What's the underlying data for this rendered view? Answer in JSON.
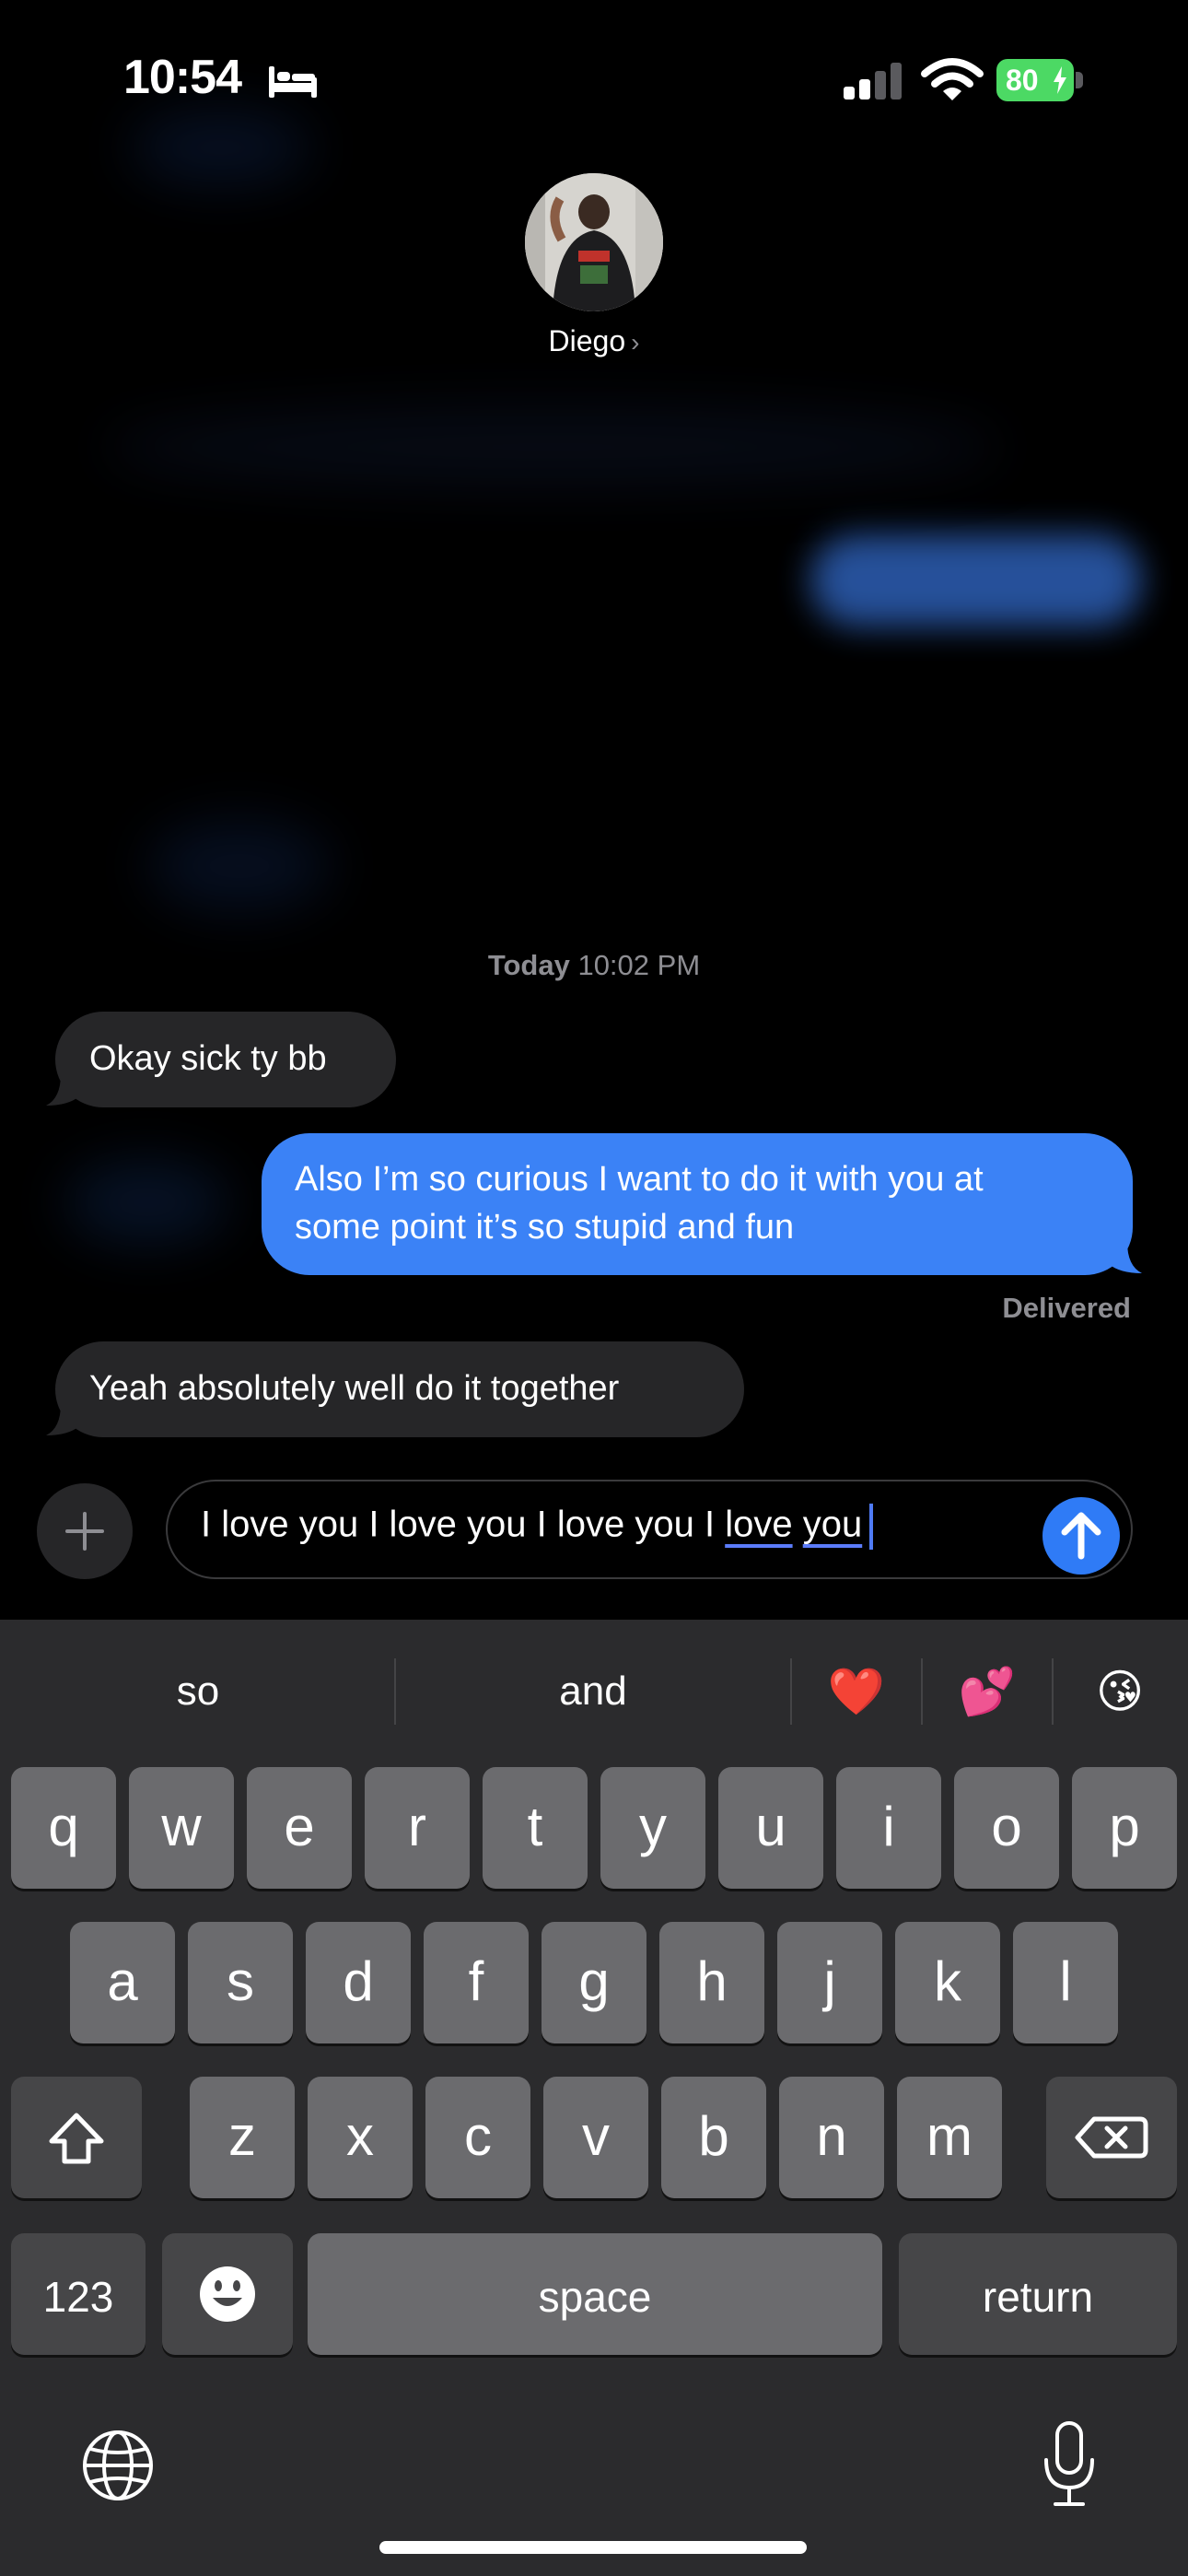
{
  "status_bar": {
    "time": "10:54",
    "battery": "80"
  },
  "contact": {
    "name": "Diego",
    "chevron": "›"
  },
  "conversation": {
    "timestamp_day": "Today",
    "timestamp_time": "10:02 PM",
    "messages": [
      {
        "direction": "incoming",
        "text": "Okay sick ty bb"
      },
      {
        "direction": "outgoing",
        "line1": "Also I’m so curious I want to do it with you at",
        "line2": "some point it’s so stupid and fun"
      },
      {
        "direction": "incoming",
        "text": "Yeah absolutely well do it together"
      }
    ],
    "delivered_label": "Delivered"
  },
  "composer": {
    "text_plain": "I love you I love you I love you I ",
    "text_underlined_1": "love",
    "text_underlined_2": "you"
  },
  "keyboard": {
    "predictions": [
      "so",
      "and"
    ],
    "emoji_predictions": [
      "❤️",
      "💕",
      "😘"
    ],
    "row1": [
      "q",
      "w",
      "e",
      "r",
      "t",
      "y",
      "u",
      "i",
      "o",
      "p"
    ],
    "row2": [
      "a",
      "s",
      "d",
      "f",
      "g",
      "h",
      "j",
      "k",
      "l"
    ],
    "row3": [
      "z",
      "x",
      "c",
      "v",
      "b",
      "n",
      "m"
    ],
    "numbers_label": "123",
    "space_label": "space",
    "return_label": "return"
  },
  "icons": [
    "bed-icon",
    "signal-icon",
    "wifi-icon",
    "battery-icon",
    "plus-icon",
    "send-arrow-icon",
    "shift-icon",
    "delete-icon",
    "emoji-face-icon",
    "globe-icon",
    "microphone-icon"
  ],
  "colors": {
    "outgoing_bubble": "#3b82f6",
    "incoming_bubble": "#262628",
    "send_button": "#2f7bf6",
    "keyboard_bg": "#2b2b2d",
    "key": "#6b6b6e",
    "key_dark": "#464648"
  }
}
